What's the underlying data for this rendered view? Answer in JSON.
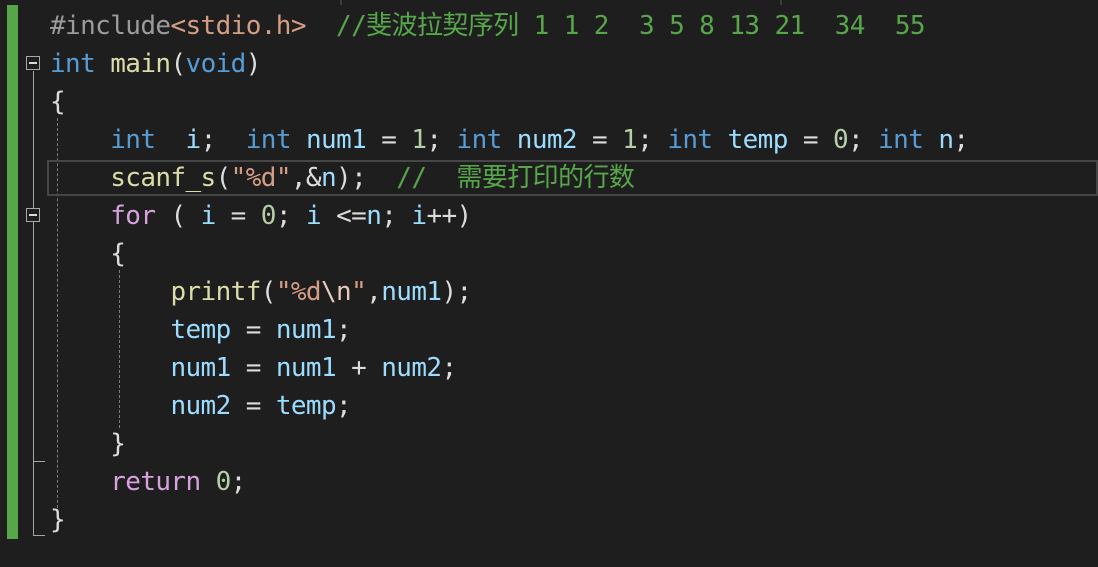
{
  "editor": {
    "lines": [
      [
        {
          "t": "#include",
          "c": "pp"
        },
        {
          "t": "<stdio.h>",
          "c": "inc"
        },
        {
          "t": "  "
        },
        {
          "t": "//斐波拉契序列 1 1 2  3 5 8 13 21  34  55",
          "c": "cmt"
        }
      ],
      [
        {
          "t": "int",
          "c": "kw"
        },
        {
          "t": " "
        },
        {
          "t": "main",
          "c": "fn"
        },
        {
          "t": "("
        },
        {
          "t": "void",
          "c": "kw"
        },
        {
          "t": ")"
        }
      ],
      [
        {
          "t": "{"
        }
      ],
      [
        {
          "t": "    "
        },
        {
          "t": "int",
          "c": "kw"
        },
        {
          "t": "  "
        },
        {
          "t": "i",
          "c": "var"
        },
        {
          "t": ";  "
        },
        {
          "t": "int",
          "c": "kw"
        },
        {
          "t": " "
        },
        {
          "t": "num1",
          "c": "var"
        },
        {
          "t": " = "
        },
        {
          "t": "1",
          "c": "num"
        },
        {
          "t": "; "
        },
        {
          "t": "int",
          "c": "kw"
        },
        {
          "t": " "
        },
        {
          "t": "num2",
          "c": "var"
        },
        {
          "t": " = "
        },
        {
          "t": "1",
          "c": "num"
        },
        {
          "t": "; "
        },
        {
          "t": "int",
          "c": "kw"
        },
        {
          "t": " "
        },
        {
          "t": "temp",
          "c": "var"
        },
        {
          "t": " = "
        },
        {
          "t": "0",
          "c": "num"
        },
        {
          "t": "; "
        },
        {
          "t": "int",
          "c": "kw"
        },
        {
          "t": " "
        },
        {
          "t": "n",
          "c": "var"
        },
        {
          "t": ";"
        }
      ],
      [
        {
          "t": "    "
        },
        {
          "t": "scanf_s",
          "c": "fn"
        },
        {
          "t": "("
        },
        {
          "t": "\"%d\"",
          "c": "str"
        },
        {
          "t": ",&"
        },
        {
          "t": "n",
          "c": "var"
        },
        {
          "t": ");  "
        },
        {
          "t": "//  需要打印的行数",
          "c": "cmt"
        }
      ],
      [
        {
          "t": "    "
        },
        {
          "t": "for",
          "c": "ctl"
        },
        {
          "t": " ( "
        },
        {
          "t": "i",
          "c": "var"
        },
        {
          "t": " = "
        },
        {
          "t": "0",
          "c": "num"
        },
        {
          "t": "; "
        },
        {
          "t": "i",
          "c": "var"
        },
        {
          "t": " <="
        },
        {
          "t": "n",
          "c": "var"
        },
        {
          "t": "; "
        },
        {
          "t": "i",
          "c": "var"
        },
        {
          "t": "++)"
        }
      ],
      [
        {
          "t": "    "
        },
        {
          "t": "{"
        }
      ],
      [
        {
          "t": "        "
        },
        {
          "t": "printf",
          "c": "fn"
        },
        {
          "t": "("
        },
        {
          "t": "\"%d",
          "c": "str"
        },
        {
          "t": "\\n",
          "c": "esc"
        },
        {
          "t": "\"",
          "c": "str"
        },
        {
          "t": ","
        },
        {
          "t": "num1",
          "c": "var"
        },
        {
          "t": ");"
        }
      ],
      [
        {
          "t": "        "
        },
        {
          "t": "temp",
          "c": "var"
        },
        {
          "t": " = "
        },
        {
          "t": "num1",
          "c": "var"
        },
        {
          "t": ";"
        }
      ],
      [
        {
          "t": "        "
        },
        {
          "t": "num1",
          "c": "var"
        },
        {
          "t": " = "
        },
        {
          "t": "num1",
          "c": "var"
        },
        {
          "t": " + "
        },
        {
          "t": "num2",
          "c": "var"
        },
        {
          "t": ";"
        }
      ],
      [
        {
          "t": "        "
        },
        {
          "t": "num2",
          "c": "var"
        },
        {
          "t": " = "
        },
        {
          "t": "temp",
          "c": "var"
        },
        {
          "t": ";"
        }
      ],
      [
        {
          "t": "    "
        },
        {
          "t": "}"
        }
      ],
      [
        {
          "t": ""
        }
      ],
      [
        {
          "t": "    "
        },
        {
          "t": "return",
          "c": "ctl"
        },
        {
          "t": " "
        },
        {
          "t": "0",
          "c": "num"
        },
        {
          "t": ";"
        }
      ],
      [
        {
          "t": "}"
        }
      ]
    ]
  }
}
